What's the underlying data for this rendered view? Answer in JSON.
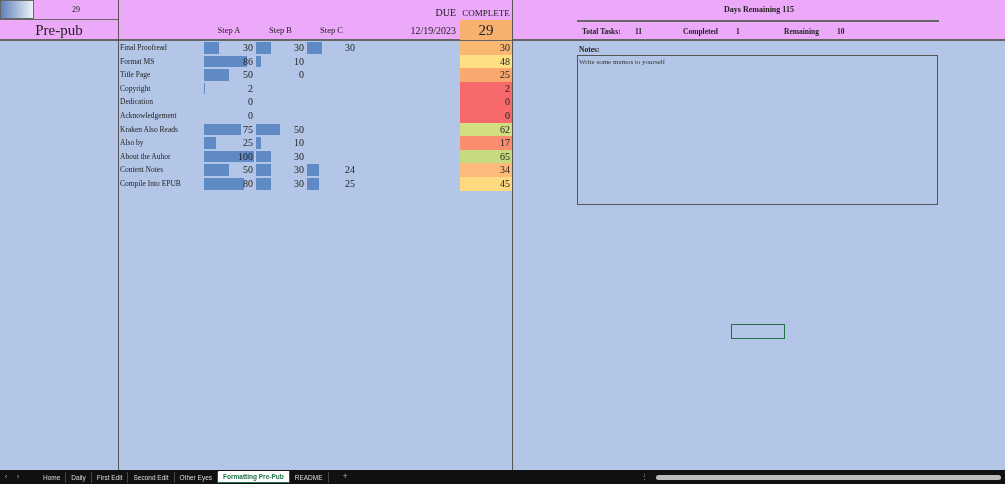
{
  "corner": {
    "value": "29"
  },
  "title": "Pre-pub",
  "header": {
    "due_label": "DUE",
    "complete_label": "COMPLETE",
    "step_labels": [
      "Step A",
      "Step B",
      "Step C"
    ],
    "due_date": "12/19/2023",
    "complete_value": "29"
  },
  "tasks": [
    {
      "name": "Final Proofread",
      "steps": [
        "30",
        "30",
        "30"
      ],
      "complete": "30",
      "color": "#f9b872"
    },
    {
      "name": "Format MS",
      "steps": [
        "86",
        "10"
      ],
      "complete": "48",
      "color": "#fee082"
    },
    {
      "name": "Title Page",
      "steps": [
        "50",
        "0"
      ],
      "complete": "25",
      "color": "#f9a86e"
    },
    {
      "name": "Copyright",
      "steps": [
        "2"
      ],
      "complete": "2",
      "color": "#f8696b"
    },
    {
      "name": "Dedication",
      "steps": [
        "0"
      ],
      "complete": "0",
      "color": "#f8696b"
    },
    {
      "name": "Acknowledgement",
      "steps": [
        "0"
      ],
      "complete": "0",
      "color": "#f8696b"
    },
    {
      "name": "Kraken Also Reads",
      "steps": [
        "75",
        "50"
      ],
      "complete": "62",
      "color": "#d2de80"
    },
    {
      "name": "Also by",
      "steps": [
        "25",
        "10"
      ],
      "complete": "17",
      "color": "#fa8d70"
    },
    {
      "name": "About the Auhor",
      "steps": [
        "100",
        "30"
      ],
      "complete": "65",
      "color": "#c6db80"
    },
    {
      "name": "Content Notes",
      "steps": [
        "50",
        "30",
        "24"
      ],
      "complete": "34",
      "color": "#fcbb7a"
    },
    {
      "name": "Compile Into EPUB",
      "steps": [
        "80",
        "30",
        "25"
      ],
      "complete": "45",
      "color": "#fed980"
    }
  ],
  "summary": {
    "days_remaining": "Days Remaining 115",
    "stats": [
      {
        "label": "Total Tasks:",
        "value": "11"
      },
      {
        "label": "Completed",
        "value": "1"
      },
      {
        "label": "Remaining",
        "value": "10"
      }
    ]
  },
  "notes": {
    "label": "Notes:",
    "value": "Write some memos to yourself"
  },
  "sheet_tabs": [
    {
      "label": "Home",
      "selected": false
    },
    {
      "label": "Daily",
      "selected": false
    },
    {
      "label": "First Edit",
      "selected": false
    },
    {
      "label": "Second Edit",
      "selected": false
    },
    {
      "label": "Other Eyes",
      "selected": false
    },
    {
      "label": "Formatting Pre-Pub",
      "selected": true
    },
    {
      "label": "README",
      "selected": false
    }
  ],
  "sheet_nav": {
    "prev": "‹",
    "next": "›",
    "add": "+",
    "more": "⋮"
  }
}
